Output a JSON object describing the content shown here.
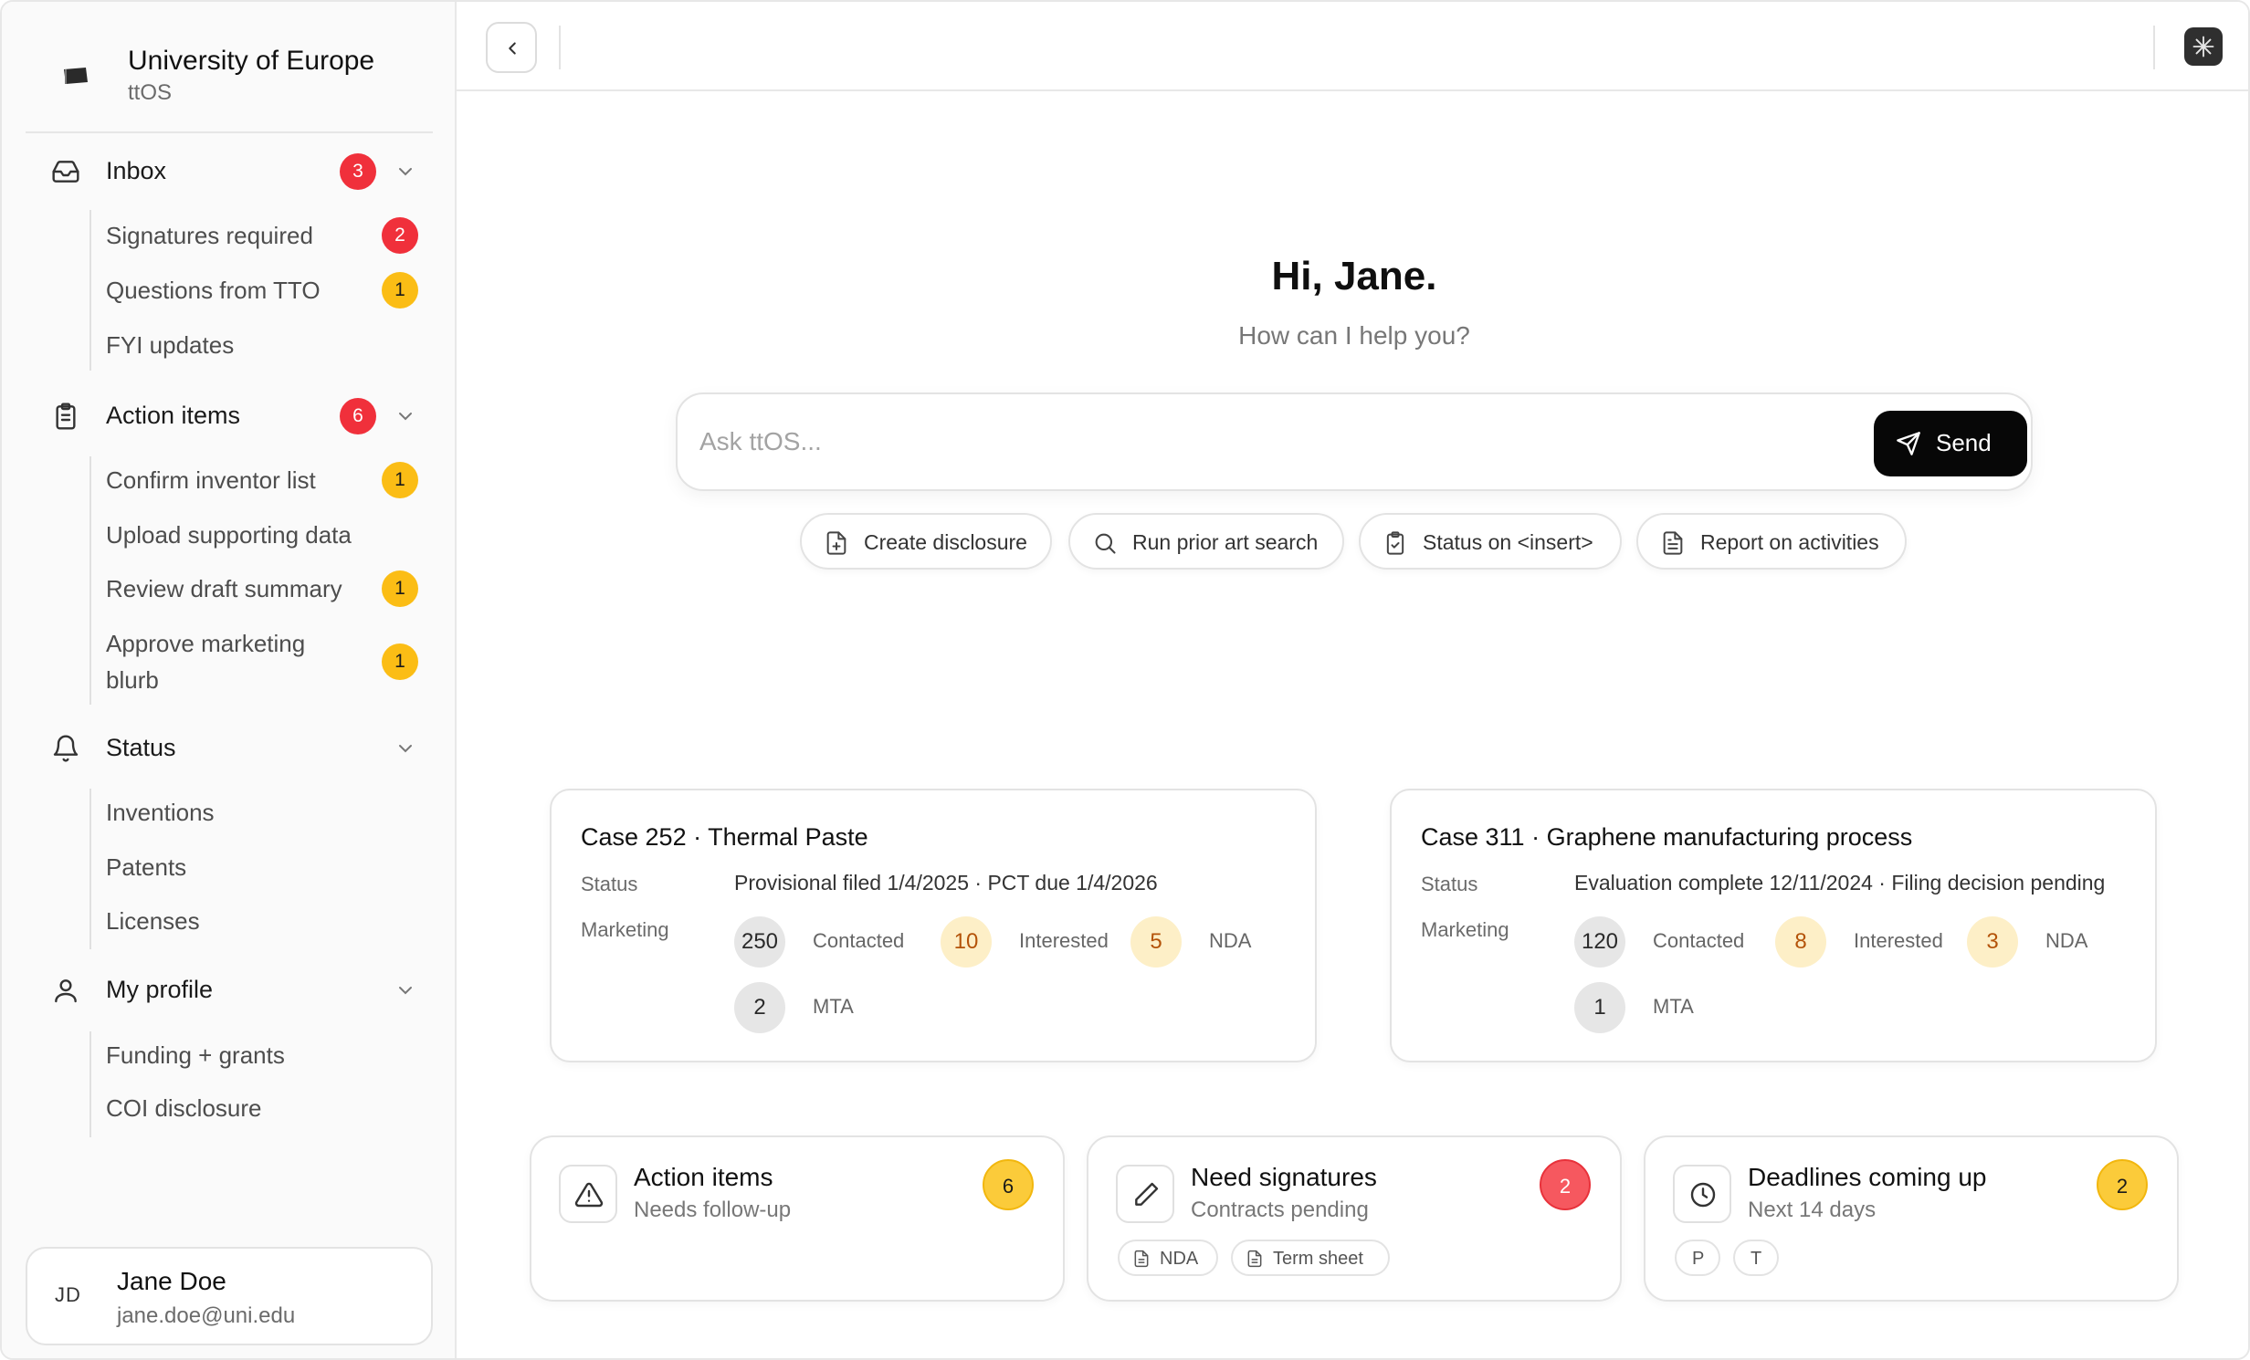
{
  "org": {
    "name": "University of Europe",
    "product": "ttOS"
  },
  "sidebar": {
    "inbox": {
      "label": "Inbox",
      "count": "3",
      "items": [
        {
          "label": "Signatures required",
          "count": "2"
        },
        {
          "label": "Questions from TTO",
          "count": "1"
        },
        {
          "label": "FYI updates"
        }
      ]
    },
    "action_items": {
      "label": "Action items",
      "count": "6",
      "items": [
        {
          "label": "Confirm inventor list",
          "count": "1"
        },
        {
          "label": "Upload supporting data"
        },
        {
          "label": "Review draft summary",
          "count": "1"
        },
        {
          "label": "Approve marketing",
          "label2": "blurb",
          "count": "1"
        }
      ]
    },
    "status": {
      "label": "Status",
      "items": [
        {
          "label": "Inventions"
        },
        {
          "label": "Patents"
        },
        {
          "label": "Licenses"
        }
      ]
    },
    "my_profile": {
      "label": "My profile",
      "items": [
        {
          "label": "Funding + grants"
        },
        {
          "label": "COI disclosure"
        }
      ]
    },
    "user": {
      "initials": "JD",
      "name": "Jane Doe",
      "email": "jane.doe@uni.edu"
    }
  },
  "hero": {
    "greeting": "Hi, Jane.",
    "subtitle": "How can I help you?",
    "placeholder": "Ask ttOS...",
    "send_label": "Send",
    "chips": [
      {
        "label": "Create disclosure",
        "icon": "file-plus-icon"
      },
      {
        "label": "Run prior art search",
        "icon": "search-icon"
      },
      {
        "label": "Status on <insert>",
        "icon": "clipboard-check-icon"
      },
      {
        "label": "Report on activities",
        "icon": "file-text-icon"
      }
    ]
  },
  "cases": [
    {
      "title": "Case 252 · Thermal Paste",
      "status_label": "Status",
      "status_value": "Provisional filed 1/4/2025 · PCT due 1/4/2026",
      "marketing_label": "Marketing",
      "metrics": [
        {
          "value": "250",
          "label": "Contacted"
        },
        {
          "value": "10",
          "label": "Interested"
        },
        {
          "value": "5",
          "label": "NDA"
        },
        {
          "value": "2",
          "label": "MTA"
        }
      ]
    },
    {
      "title": "Case 311 · Graphene manufacturing process",
      "status_label": "Status",
      "status_value": "Evaluation complete 12/11/2024 · Filing decision pending",
      "marketing_label": "Marketing",
      "metrics": [
        {
          "value": "120",
          "label": "Contacted"
        },
        {
          "value": "8",
          "label": "Interested"
        },
        {
          "value": "3",
          "label": "NDA"
        },
        {
          "value": "1",
          "label": "MTA"
        }
      ]
    }
  ],
  "summary": [
    {
      "title": "Action items",
      "subtitle": "Needs follow-up",
      "count": "6",
      "icon": "alert-triangle-icon"
    },
    {
      "title": "Need signatures",
      "subtitle": "Contracts pending",
      "count": "2",
      "icon": "pen-icon",
      "tags": [
        "NDA",
        "Term sheet"
      ]
    },
    {
      "title": "Deadlines coming up",
      "subtitle": "Next 14 days",
      "count": "2",
      "icon": "clock-icon",
      "tags": [
        "P",
        "T"
      ]
    }
  ],
  "colors": {
    "badge_red": "#f0303b",
    "badge_yellow": "#fbbd15",
    "send_bg": "#070707",
    "amber_circle": "#fdefc7",
    "amber_text": "#b45309"
  }
}
